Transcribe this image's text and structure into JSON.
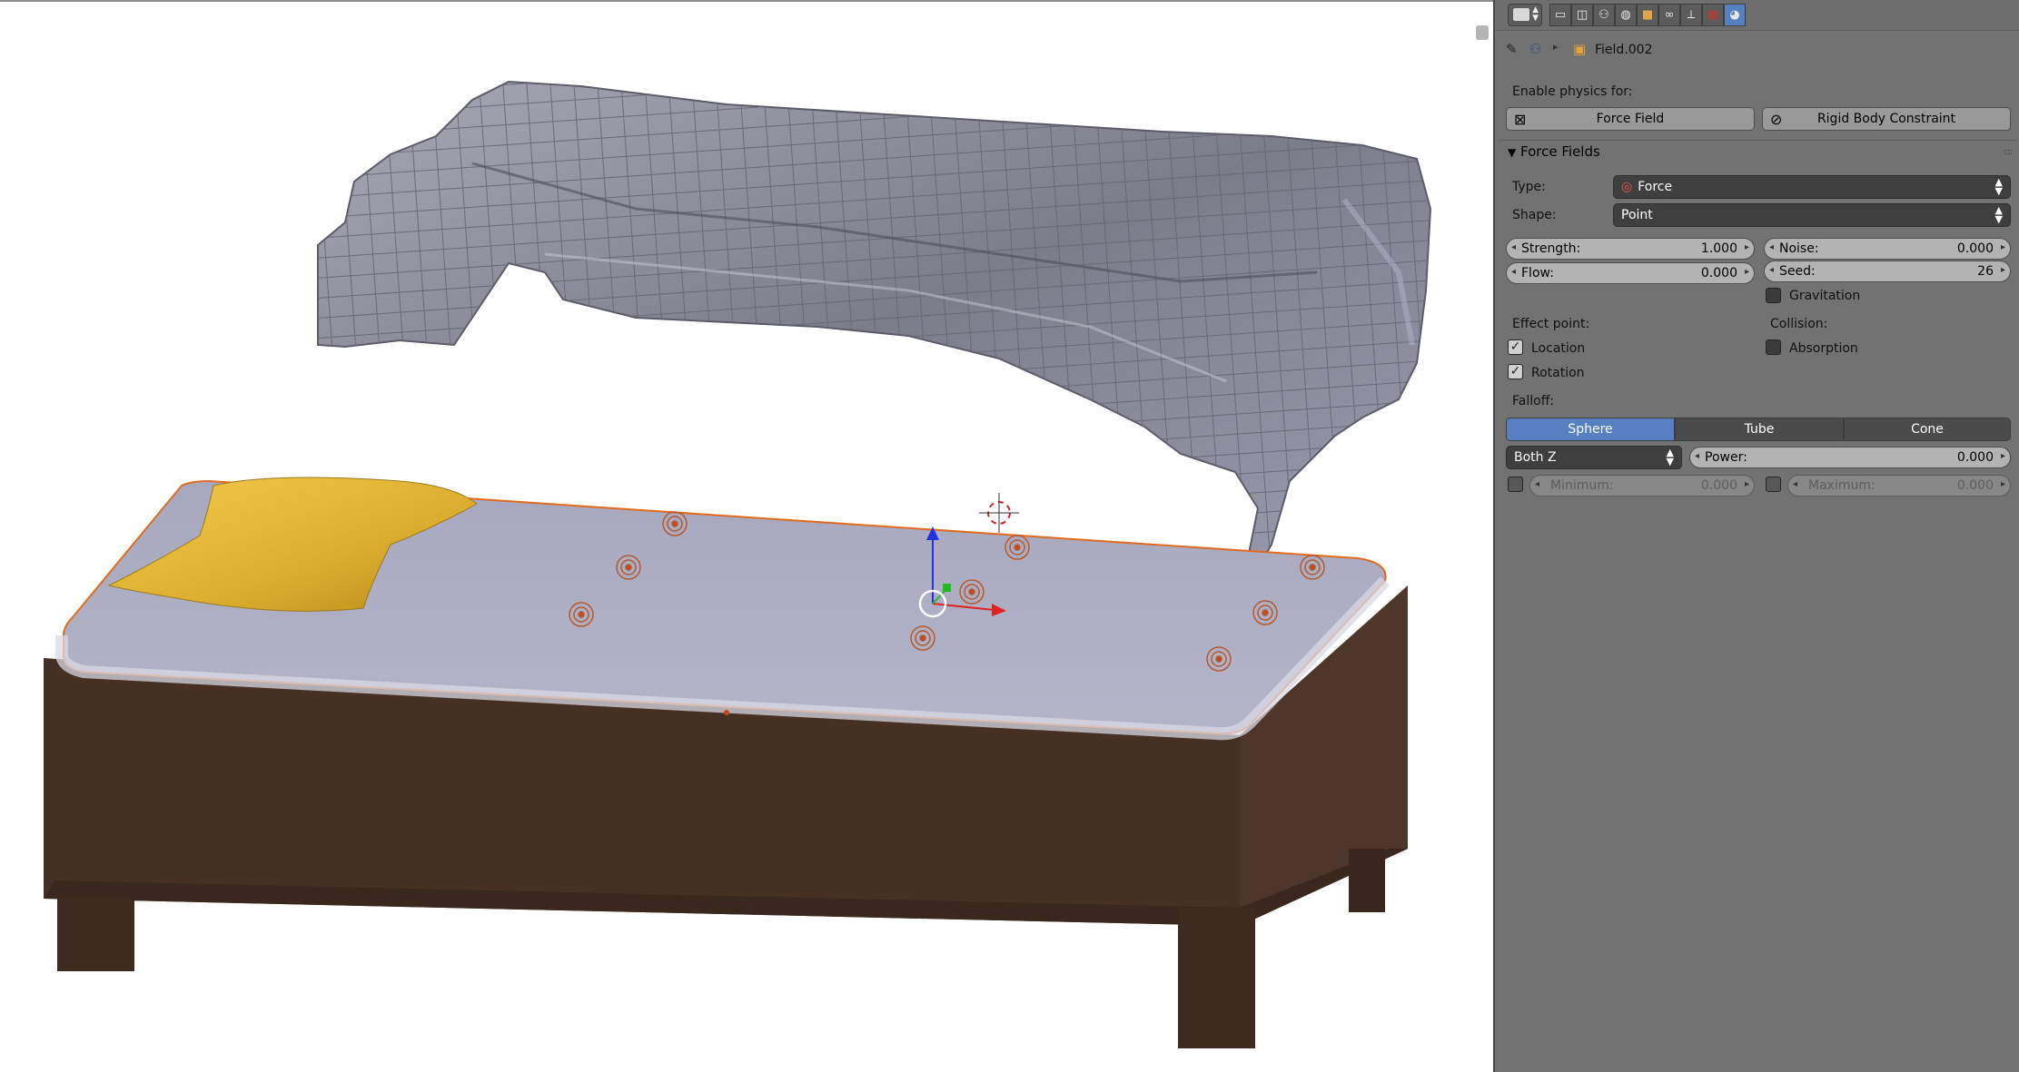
{
  "header": {
    "icons": [
      "view-icon",
      "render-icon",
      "render-layers-icon",
      "scene-icon",
      "world-icon",
      "object-icon",
      "constraints-icon",
      "modifiers-icon",
      "texture-icon",
      "physics-icon"
    ],
    "breadcrumb": {
      "object_name": "Field.002"
    }
  },
  "enable_physics": {
    "label": "Enable physics for:",
    "force_field_label": "Force Field",
    "rigid_body_label": "Rigid Body Constraint"
  },
  "force_fields": {
    "title": "Force Fields",
    "type_label": "Type:",
    "type_value": "Force",
    "shape_label": "Shape:",
    "shape_value": "Point",
    "strength_label": "Strength:",
    "strength_value": "1.000",
    "noise_label": "Noise:",
    "noise_value": "0.000",
    "flow_label": "Flow:",
    "flow_value": "0.000",
    "seed_label": "Seed:",
    "seed_value": "26",
    "gravitation_label": "Gravitation",
    "gravitation_checked": false,
    "effect_point_label": "Effect point:",
    "location_label": "Location",
    "location_checked": true,
    "rotation_label": "Rotation",
    "rotation_checked": true,
    "collision_label": "Collision:",
    "absorption_label": "Absorption",
    "absorption_checked": false,
    "falloff_label": "Falloff:",
    "falloff_options": [
      "Sphere",
      "Tube",
      "Cone"
    ],
    "falloff_active": "Sphere",
    "z_direction_value": "Both Z",
    "power_label": "Power:",
    "power_value": "0.000",
    "minimum_label": "Minimum:",
    "minimum_value": "0.000",
    "maximum_label": "Maximum:",
    "maximum_value": "0.000"
  },
  "colors": {
    "active_blue": "#5680c2",
    "panel_bg": "#727272",
    "bed_frame": "#4a3427",
    "mattress": "#a6a6bd",
    "pillow": "#e8b73a",
    "cloth": "#8a8a99",
    "selection_outline": "#e06b1f"
  }
}
